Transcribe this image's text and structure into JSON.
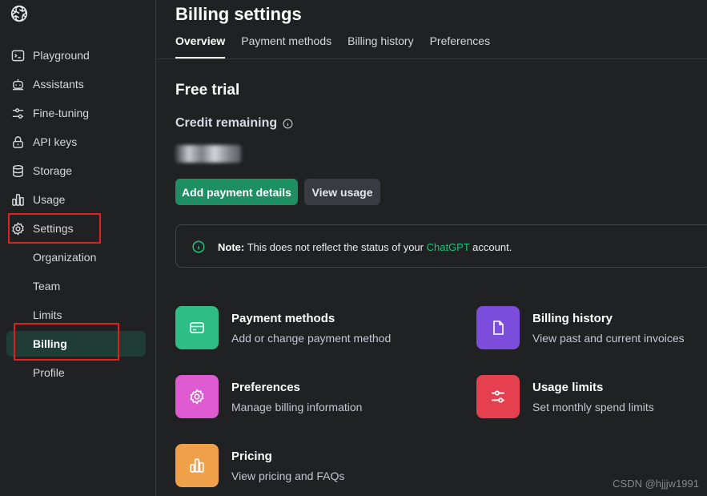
{
  "sidebar": {
    "items": [
      {
        "label": "Playground",
        "icon": "terminal-icon"
      },
      {
        "label": "Assistants",
        "icon": "robot-icon"
      },
      {
        "label": "Fine-tuning",
        "icon": "sliders-icon"
      },
      {
        "label": "API keys",
        "icon": "lock-icon"
      },
      {
        "label": "Storage",
        "icon": "database-icon"
      },
      {
        "label": "Usage",
        "icon": "bar-chart-icon"
      },
      {
        "label": "Settings",
        "icon": "gear-icon"
      }
    ],
    "sub_items": [
      {
        "label": "Organization"
      },
      {
        "label": "Team"
      },
      {
        "label": "Limits"
      },
      {
        "label": "Billing",
        "active": true
      },
      {
        "label": "Profile"
      }
    ]
  },
  "header": {
    "title": "Billing settings",
    "tabs": [
      {
        "label": "Overview",
        "active": true
      },
      {
        "label": "Payment methods"
      },
      {
        "label": "Billing history"
      },
      {
        "label": "Preferences"
      }
    ]
  },
  "main": {
    "plan": "Free trial",
    "credit_label": "Credit remaining",
    "add_payment_label": "Add payment details",
    "view_usage_label": "View usage",
    "note": {
      "bold": "Note:",
      "text_before": " This does not reflect the status of your ",
      "link": "ChatGPT",
      "text_after": " account."
    },
    "cards": [
      {
        "title": "Payment methods",
        "desc": "Add or change payment method",
        "icon": "credit-card-icon",
        "color": "#2ebd85"
      },
      {
        "title": "Billing history",
        "desc": "View past and current invoices",
        "icon": "document-icon",
        "color": "#7c4ddb"
      },
      {
        "title": "Preferences",
        "desc": "Manage billing information",
        "icon": "gear-icon",
        "color": "#dd5ad0"
      },
      {
        "title": "Usage limits",
        "desc": "Set monthly spend limits",
        "icon": "sliders-icon",
        "color": "#e5404f"
      },
      {
        "title": "Pricing",
        "desc": "View pricing and FAQs",
        "icon": "bar-chart-icon",
        "color": "#f0a048"
      }
    ]
  },
  "watermark": "CSDN @hjjjw1991",
  "colors": {
    "background": "#202123",
    "accent_green": "#1e8f63",
    "active_nav": "#1f3d34",
    "annotation_red": "#e02020"
  }
}
